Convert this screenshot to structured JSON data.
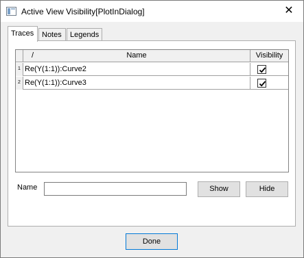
{
  "window": {
    "title": "Active View Visibility[PlotInDialog]",
    "close_glyph": "✕",
    "icon": "app-window-icon"
  },
  "tabs": [
    {
      "label": "Traces",
      "active": true
    },
    {
      "label": "Notes",
      "active": false
    },
    {
      "label": "Legends",
      "active": false
    }
  ],
  "grid": {
    "columns": {
      "sort": "/",
      "name": "Name",
      "visibility": "Visibility"
    },
    "rows": [
      {
        "num": "1",
        "name": "Re(Y(1:1)):Curve2",
        "visible": true
      },
      {
        "num": "2",
        "name": "Re(Y(1:1)):Curve3",
        "visible": true
      }
    ]
  },
  "name_field": {
    "label": "Name",
    "value": ""
  },
  "buttons": {
    "show": "Show",
    "hide": "Hide",
    "done": "Done"
  },
  "colors": {
    "accent": "#0078d7",
    "panel": "#f0f0f0"
  }
}
